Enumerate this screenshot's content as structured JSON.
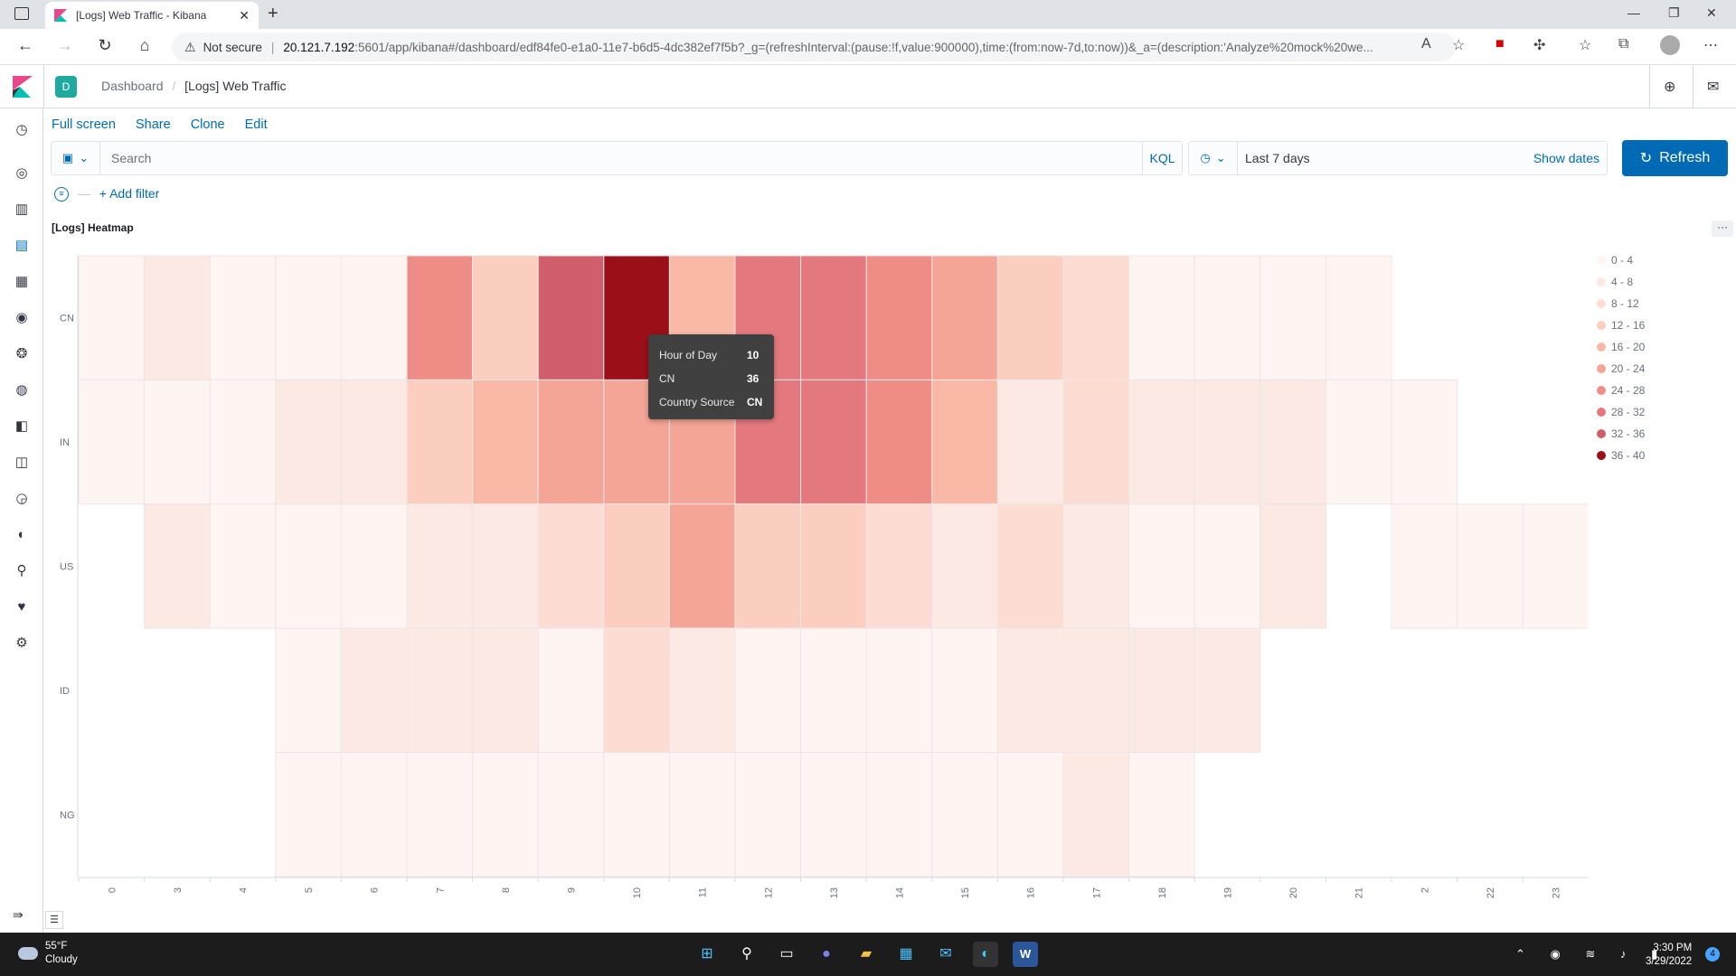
{
  "browser": {
    "tab_title": "[Logs] Web Traffic - Kibana",
    "new_tab": "+",
    "security_label": "Not secure",
    "url_host": "20.121.7.192",
    "url_path": ":5601/app/kibana#/dashboard/edf84fe0-e1a0-11e7-b6d5-4dc382ef7f5b?_g=(refreshInterval:(pause:!f,value:900000),time:(from:now-7d,to:now))&_a=(description:'Analyze%20mock%20we..."
  },
  "header": {
    "space_initial": "D",
    "breadcrumb_parent": "Dashboard",
    "breadcrumb_current": "[Logs] Web Traffic"
  },
  "toolbar": {
    "full_screen": "Full screen",
    "share": "Share",
    "clone": "Clone",
    "edit": "Edit"
  },
  "query": {
    "placeholder": "Search",
    "language": "KQL",
    "time_range": "Last 7 days",
    "show_dates": "Show dates",
    "refresh": "Refresh",
    "add_filter": "+ Add filter"
  },
  "panel": {
    "title": "[Logs] Heatmap",
    "menu": "···"
  },
  "tooltip": {
    "rows": [
      {
        "key": "Hour of Day",
        "value": "10"
      },
      {
        "key": "CN",
        "value": "36"
      },
      {
        "key": "Country Source",
        "value": "CN"
      }
    ]
  },
  "colors": {
    "accent": "#006bb4",
    "scale": [
      "#fef5f3",
      "#fde9e4",
      "#fcdcd3",
      "#fbcebf",
      "#f9b9a6",
      "#f5a595",
      "#ee8c86",
      "#e3787e",
      "#d15e6b",
      "#9b0f18"
    ]
  },
  "legend": [
    "0 - 4",
    "4 - 8",
    "8 - 12",
    "12 - 16",
    "16 - 20",
    "20 - 24",
    "24 - 28",
    "28 - 32",
    "32 - 36",
    "36 - 40"
  ],
  "taskbar": {
    "temp": "55°F",
    "condition": "Cloudy",
    "time": "3:30 PM",
    "date": "3/29/2022",
    "notifications": "4"
  },
  "chart_data": {
    "type": "heatmap",
    "xlabel": "Hour of Day",
    "ylabel": "",
    "categories_x": [
      "0",
      "3",
      "4",
      "5",
      "6",
      "7",
      "8",
      "9",
      "10",
      "11",
      "12",
      "13",
      "14",
      "15",
      "16",
      "17",
      "18",
      "19",
      "20",
      "21",
      "2",
      "22",
      "23"
    ],
    "categories_y": [
      "CN",
      "IN",
      "US",
      "ID",
      "NG"
    ],
    "legend_position": "right",
    "values": [
      [
        1,
        6,
        1,
        3,
        3,
        25,
        13,
        33,
        38,
        17,
        30,
        31,
        26,
        20,
        15,
        11,
        3,
        3,
        2,
        2,
        null,
        null,
        null
      ],
      [
        2,
        1,
        3,
        6,
        6,
        12,
        17,
        20,
        21,
        21,
        29,
        30,
        25,
        18,
        7,
        8,
        5,
        5,
        4,
        3,
        3,
        null,
        null
      ],
      [
        null,
        4,
        1,
        3,
        1,
        6,
        7,
        11,
        15,
        22,
        12,
        14,
        10,
        4,
        10,
        4,
        2,
        0,
        4,
        null,
        3,
        2,
        2
      ],
      [
        null,
        null,
        null,
        2,
        5,
        5,
        5,
        3,
        9,
        4,
        1,
        3,
        1,
        1,
        6,
        4,
        4,
        5,
        null,
        null,
        null,
        null,
        null
      ],
      [
        null,
        null,
        null,
        2,
        1,
        2,
        2,
        1,
        3,
        1,
        1,
        3,
        1,
        0,
        1,
        6,
        2,
        null,
        null,
        null,
        null,
        null,
        null
      ]
    ]
  }
}
